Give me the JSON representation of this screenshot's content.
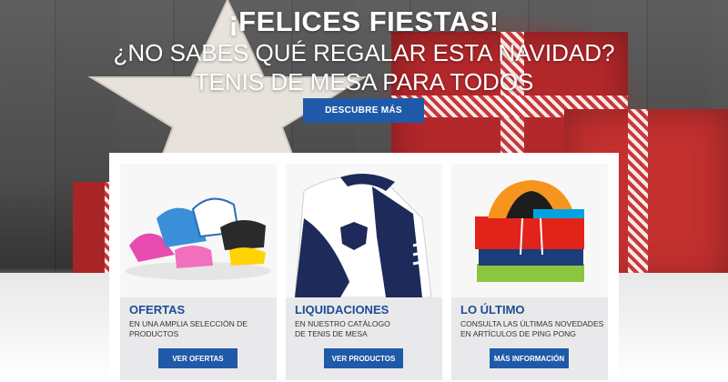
{
  "hero": {
    "title": "¡FELICES FIESTAS!",
    "subtitle": "¿NO SABES QUÉ REGALAR ESTA NAVIDAD?",
    "tagline": "TENIS DE MESA PARA TODOS",
    "cta_label": "DESCUBRE MÁS"
  },
  "cards": [
    {
      "title": "OFERTAS",
      "desc_line1": "EN UNA AMPLIA SELECCIÓN DE",
      "desc_line2": "PRODUCTOS",
      "button": "VER OFERTAS",
      "image": "sneakers-image"
    },
    {
      "title": "LIQUIDACIONES",
      "desc_line1": "EN NUESTRO CATÁLOGO",
      "desc_line2": "DE TENIS DE MESA",
      "button": "VER PRODUCTOS",
      "image": "jacket-image"
    },
    {
      "title": "LO ÚLTIMO",
      "desc_line1": "CONSULTA LAS ÚLTIMAS NOVEDADES",
      "desc_line2": "EN ARTÍCULOS DE PING PONG",
      "button": "MÁS INFORMACIÓN",
      "image": "hoodies-image"
    }
  ],
  "colors": {
    "accent": "#1f5aa8",
    "title": "#1b4e91"
  }
}
